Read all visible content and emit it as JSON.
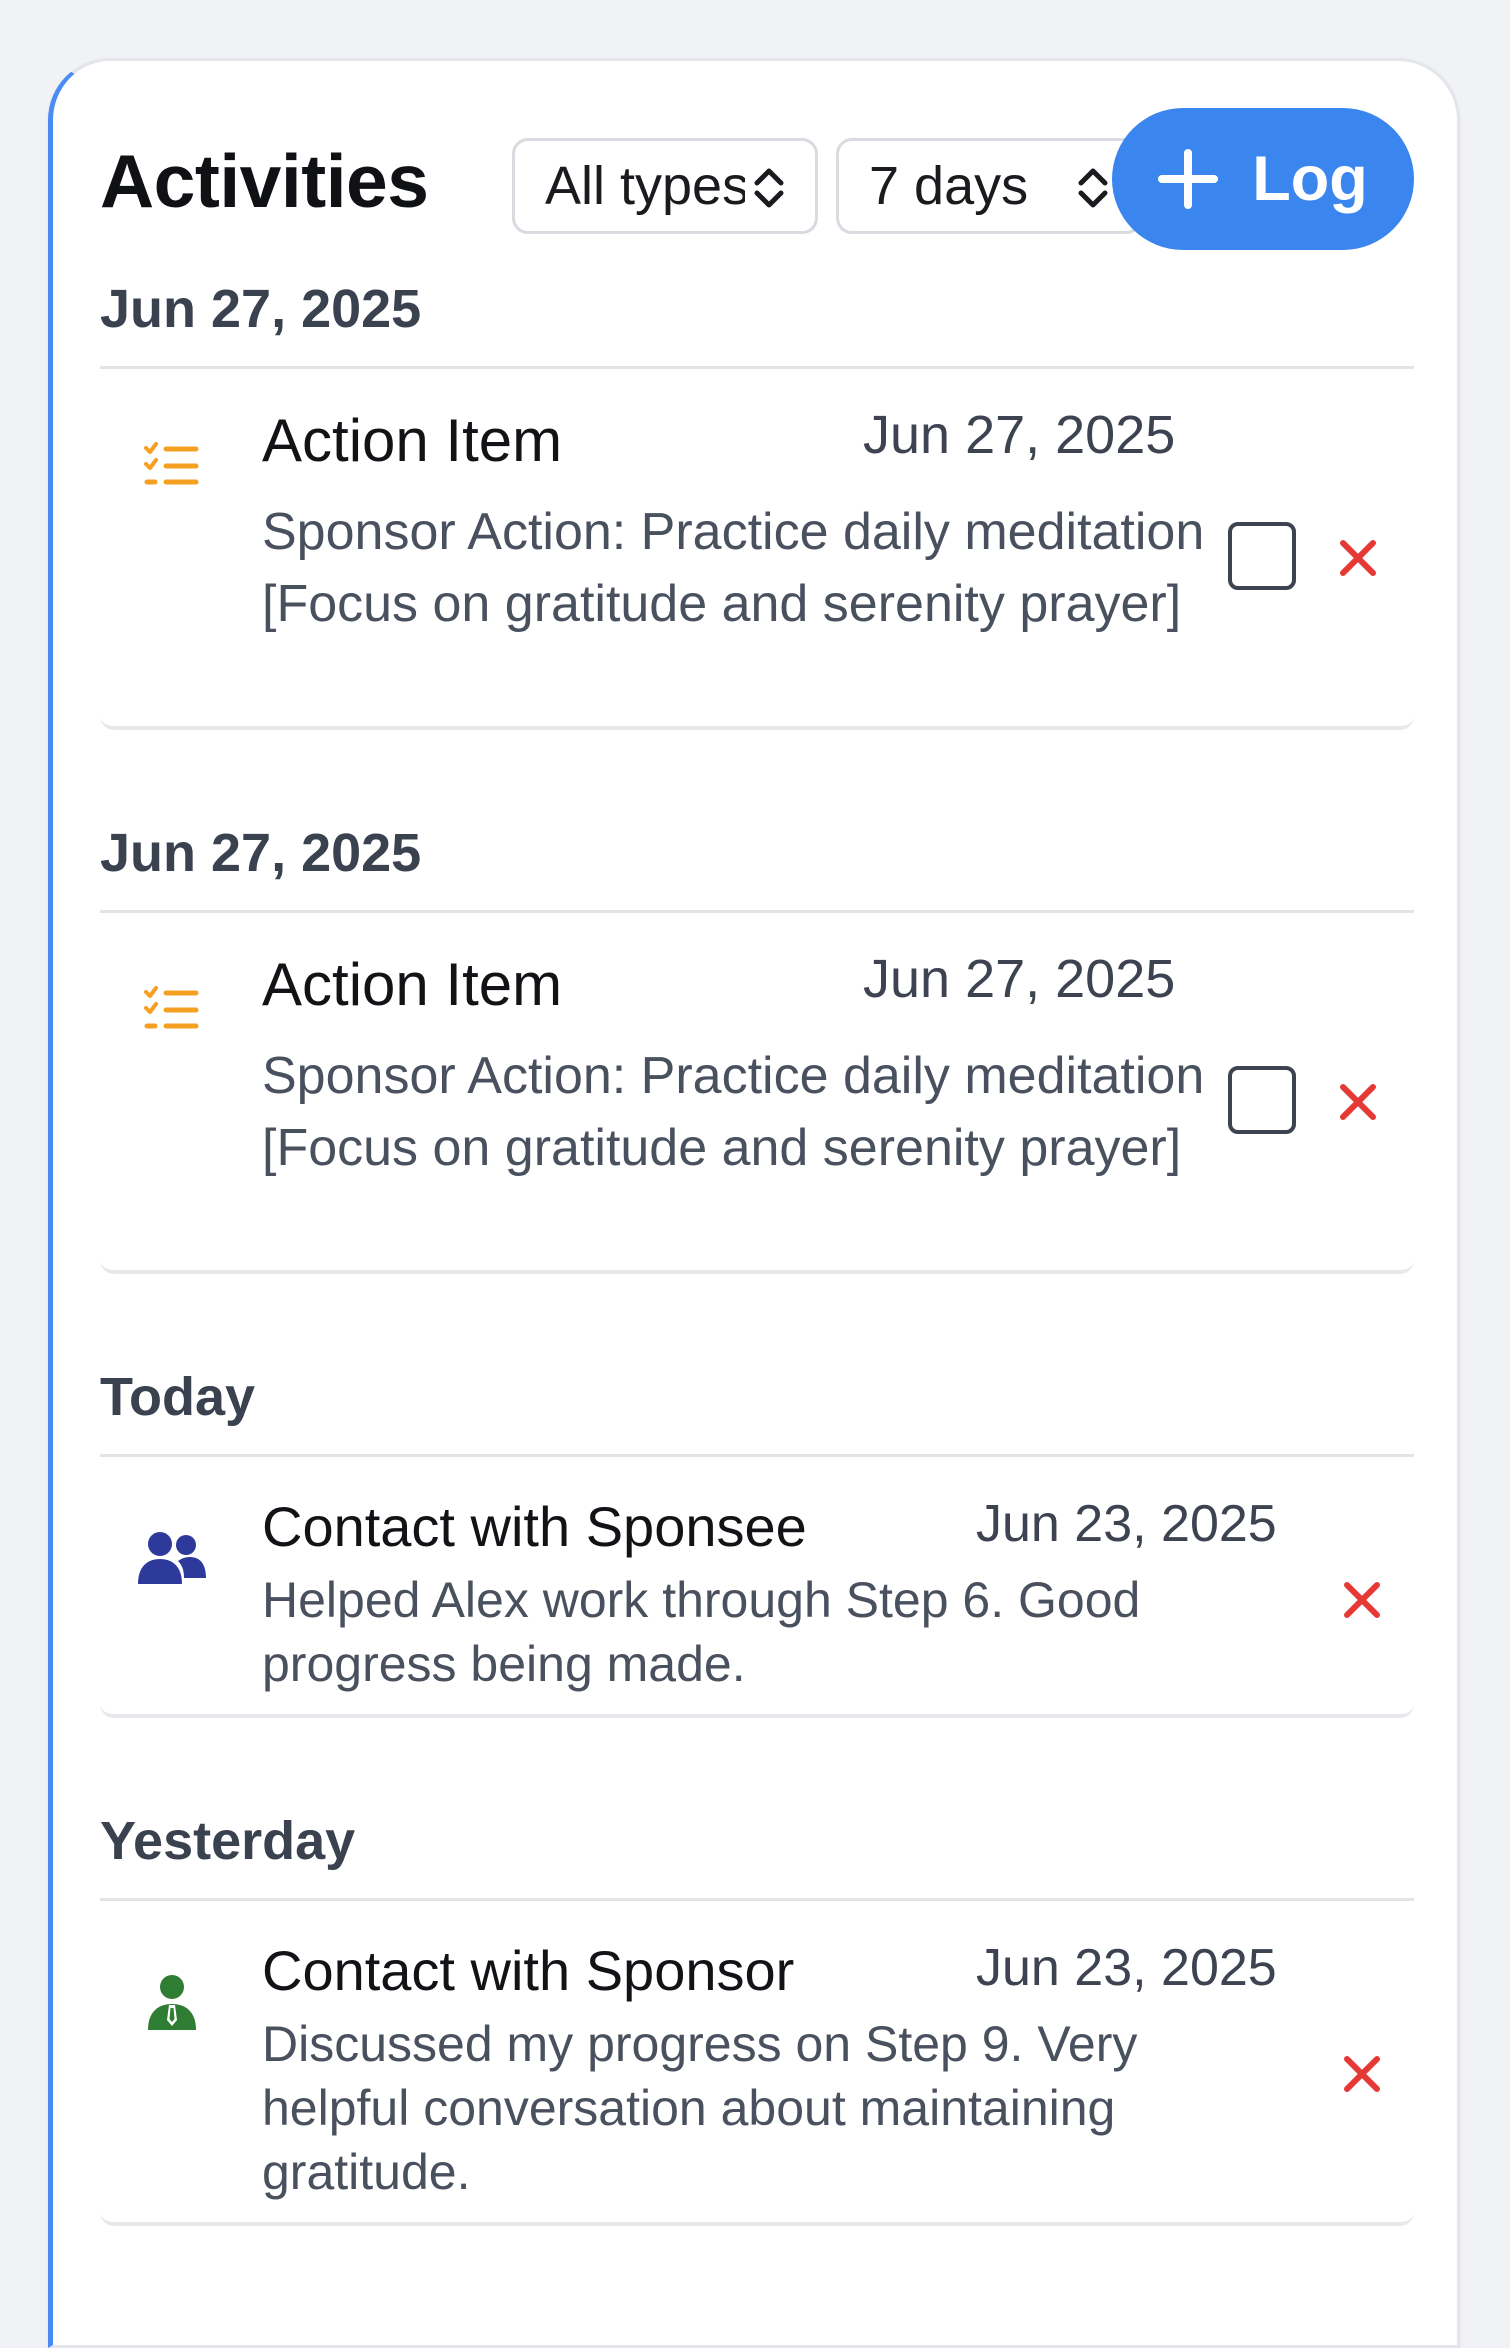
{
  "header": {
    "title": "Activities",
    "type_filter": {
      "value": "All types"
    },
    "range_filter": {
      "value": "7 days"
    },
    "log_button": {
      "label": "Log"
    }
  },
  "sections": [
    {
      "heading": "Jun 27, 2025",
      "items": [
        {
          "icon": "checklist-icon",
          "icon_color": "#f5a021",
          "title": "Action Item",
          "date": "Jun 27, 2025",
          "description": "Sponsor Action: Practice daily meditation [Focus on gratitude and serenity prayer]",
          "has_checkbox": true,
          "checked": false
        }
      ]
    },
    {
      "heading": "Jun 27, 2025",
      "items": [
        {
          "icon": "checklist-icon",
          "icon_color": "#f5a021",
          "title": "Action Item",
          "date": "Jun 27, 2025",
          "description": "Sponsor Action: Practice daily meditation [Focus on gratitude and serenity prayer]",
          "has_checkbox": true,
          "checked": false
        }
      ]
    },
    {
      "heading": "Today",
      "items": [
        {
          "icon": "users-icon",
          "icon_color": "#2d3a9b",
          "title": "Contact with Sponsee",
          "date": "Jun 23, 2025",
          "description": "Helped Alex work through Step 6. Good progress being made.",
          "has_checkbox": false
        }
      ]
    },
    {
      "heading": "Yesterday",
      "items": [
        {
          "icon": "person-tie-icon",
          "icon_color": "#2e7d32",
          "title": "Contact with Sponsor",
          "date": "Jun 23, 2025",
          "description": "Discussed my progress on Step 9. Very helpful conversation about maintaining gratitude.",
          "has_checkbox": false
        }
      ]
    }
  ],
  "colors": {
    "accent": "#3b86ee",
    "delete": "#e53935",
    "card_border_accent": "#4a8cf2"
  }
}
